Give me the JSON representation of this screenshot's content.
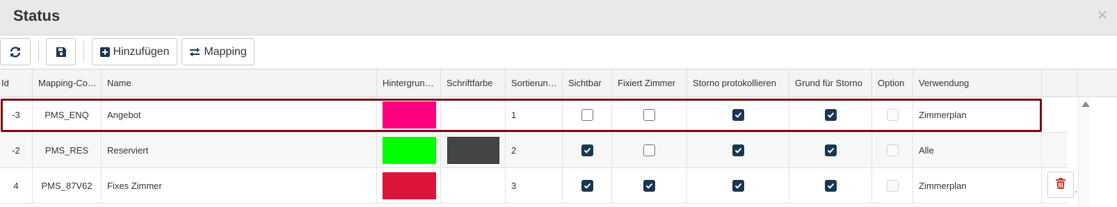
{
  "dialog": {
    "title": "Status",
    "close_glyph": "×"
  },
  "toolbar": {
    "refresh_icon": "refresh-icon",
    "save_icon": "save-icon",
    "add_label": "Hinzufügen",
    "mapping_label": "Mapping"
  },
  "table": {
    "columns": [
      "Id",
      "Mapping-Co…",
      "Name",
      "Hintergrun…",
      "Schriftfarbe",
      "Sortierun…",
      "Sichtbar",
      "Fixiert Zimmer",
      "Storno protokollieren",
      "Grund für Storno",
      "Option",
      "Verwendung"
    ],
    "rows": [
      {
        "id": "-3",
        "mapping_code": "PMS_ENQ",
        "name": "Angebot",
        "background": "#ff0080",
        "font_color": "",
        "sort": "1",
        "visible": false,
        "fixed_room": false,
        "cancel_log": true,
        "cancel_reason": true,
        "option": false,
        "usage": "Zimmerplan"
      },
      {
        "id": "-2",
        "mapping_code": "PMS_RES",
        "name": "Reserviert",
        "background": "#00ff00",
        "font_color": "#444444",
        "sort": "2",
        "visible": true,
        "fixed_room": false,
        "cancel_log": true,
        "cancel_reason": true,
        "option": false,
        "usage": "Alle"
      },
      {
        "id": "4",
        "mapping_code": "PMS_87V62",
        "name": "Fixes Zimmer",
        "background": "#dc143c",
        "font_color": "",
        "sort": "3",
        "visible": true,
        "fixed_room": true,
        "cancel_log": true,
        "cancel_reason": true,
        "option": false,
        "usage": "Zimmerplan"
      }
    ],
    "row_action_more": "…"
  },
  "colors": {
    "accent": "#1d3650",
    "selection_border": "#7a0c15",
    "delete": "#c0392b"
  }
}
